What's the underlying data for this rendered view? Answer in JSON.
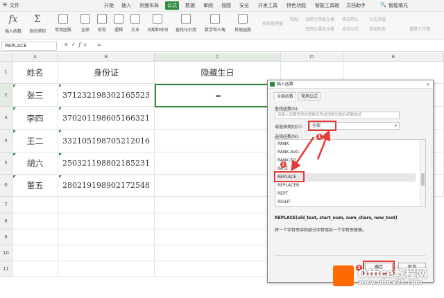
{
  "menubar": {
    "file": "文件",
    "tabs": [
      "开始",
      "插入",
      "页面布局",
      "公式",
      "数据",
      "审阅",
      "视图",
      "安全",
      "开发工具",
      "特色功能",
      "智能工具箱",
      "文档助手"
    ],
    "active_tab": "公式",
    "search_label": "智能填充"
  },
  "ribbon": {
    "buttons": [
      "插入函数",
      "自动求和",
      "常用函数",
      "全部",
      "财务",
      "逻辑",
      "文本",
      "日期和时间",
      "查找与引用",
      "数学和三角",
      "其他函数"
    ],
    "right_items": [
      "名称管理器",
      "粘贴",
      "追踪引用单元格",
      "追踪从属单元格",
      "移去箭头",
      "显示公式",
      "公式求值",
      "错误检查",
      "重算工作簿"
    ]
  },
  "formula_bar": {
    "name_box": "REPLACE",
    "value": "="
  },
  "sheet": {
    "columns": [
      "A",
      "B",
      "C",
      "D",
      "E"
    ],
    "selected_column": "C",
    "rows": [
      "1",
      "2",
      "3",
      "4",
      "5",
      "6",
      "7",
      "8",
      "9",
      "10",
      "11"
    ],
    "selected_row": "2",
    "headers": [
      "姓名",
      "身份证",
      "隐藏生日"
    ],
    "data": [
      {
        "name": "张三",
        "id": "371232198302165523",
        "birth": "="
      },
      {
        "name": "李四",
        "id": "370201198605166321",
        "birth": ""
      },
      {
        "name": "王二",
        "id": "332105198705212016",
        "birth": ""
      },
      {
        "name": "胡六",
        "id": "250321198802185231",
        "birth": ""
      },
      {
        "name": "董五",
        "id": "280219198902172548",
        "birth": ""
      }
    ]
  },
  "dialog": {
    "title": "插入函数",
    "close": "×",
    "tabs": [
      "全部函数",
      "常用公式"
    ],
    "search_label": "查找函数(S):",
    "search_placeholder": "请输入您要查找的函数名称或函数功能的简要描述",
    "category_label": "或选择类别(C):",
    "category_value": "全部",
    "list_label": "选择函数(N):",
    "functions": [
      "RANK",
      "RANK.AVG",
      "RANK.EQ",
      "RATE",
      "REPLACE",
      "REPLACEB",
      "REPT",
      "RIGHT"
    ],
    "selected_function": "REPLACE",
    "syntax": "REPLACE(old_text, start_num, num_chars, new_text)",
    "description": "将一个字符串中的部分字符用另一个字符串替换。",
    "ok": "确定",
    "cancel": "取消"
  },
  "annotations": {
    "badge1": "1",
    "badge2": "2",
    "badge3": "3",
    "color": "#e53935"
  },
  "watermark": {
    "line1": "Office教程网",
    "line2": "www.office26.com"
  }
}
